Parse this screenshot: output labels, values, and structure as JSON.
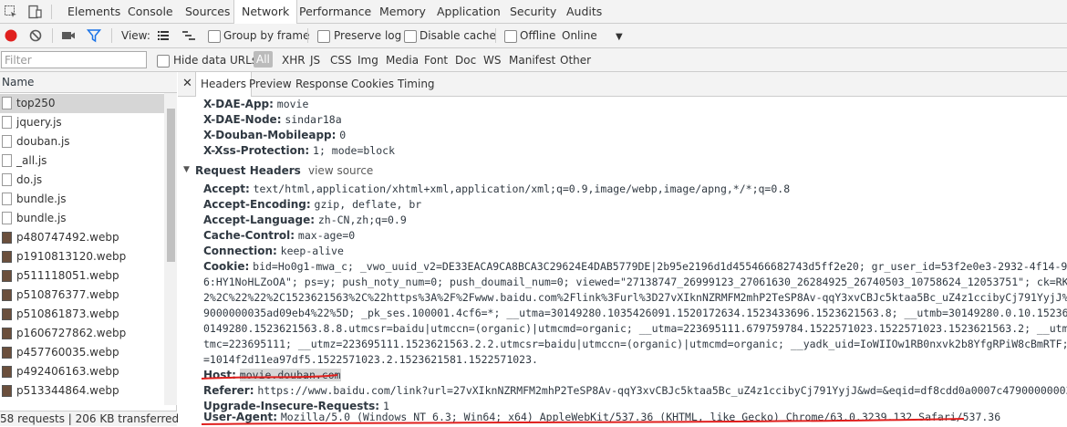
{
  "topbar": {
    "tabs": [
      "Elements",
      "Console",
      "Sources",
      "Network",
      "Performance",
      "Memory",
      "Application",
      "Security",
      "Audits"
    ],
    "active_tab": "Network"
  },
  "toolbar": {
    "view_label": "View:",
    "group_by_frame": "Group by frame",
    "preserve_log": "Preserve log",
    "disable_cache": "Disable cache",
    "offline": "Offline",
    "throttle": "Online"
  },
  "filterbar": {
    "placeholder": "Filter",
    "hide_data_urls": "Hide data URLs",
    "types": [
      "All",
      "XHR",
      "JS",
      "CSS",
      "Img",
      "Media",
      "Font",
      "Doc",
      "WS",
      "Manifest",
      "Other"
    ]
  },
  "requests": {
    "header": "Name",
    "items": [
      {
        "name": "top250",
        "kind": "doc"
      },
      {
        "name": "jquery.js",
        "kind": "doc"
      },
      {
        "name": "douban.js",
        "kind": "doc"
      },
      {
        "name": "_all.js",
        "kind": "doc"
      },
      {
        "name": "do.js",
        "kind": "doc"
      },
      {
        "name": "bundle.js",
        "kind": "doc"
      },
      {
        "name": "bundle.js",
        "kind": "doc"
      },
      {
        "name": "p480747492.webp",
        "kind": "img"
      },
      {
        "name": "p1910813120.webp",
        "kind": "img"
      },
      {
        "name": "p511118051.webp",
        "kind": "img"
      },
      {
        "name": "p510876377.webp",
        "kind": "img"
      },
      {
        "name": "p510861873.webp",
        "kind": "img"
      },
      {
        "name": "p1606727862.webp",
        "kind": "img"
      },
      {
        "name": "p457760035.webp",
        "kind": "img"
      },
      {
        "name": "p492406163.webp",
        "kind": "img"
      },
      {
        "name": "p513344864.webp",
        "kind": "img"
      }
    ],
    "status": "58 requests  |  206 KB transferred  |  F"
  },
  "detail_tabs": [
    "Headers",
    "Preview",
    "Response",
    "Cookies",
    "Timing"
  ],
  "response_headers": [
    {
      "key": "X-DAE-App:",
      "value": "movie"
    },
    {
      "key": "X-DAE-Node:",
      "value": "sindar18a"
    },
    {
      "key": "X-Douban-Mobileapp:",
      "value": "0"
    },
    {
      "key": "X-Xss-Protection:",
      "value": "1; mode=block"
    }
  ],
  "request_section": {
    "title": "Request Headers",
    "view_source": "view source"
  },
  "request_headers": {
    "accept": {
      "key": "Accept:",
      "value": "text/html,application/xhtml+xml,application/xml;q=0.9,image/webp,image/apng,*/*;q=0.8"
    },
    "accept_encoding": {
      "key": "Accept-Encoding:",
      "value": "gzip, deflate, br"
    },
    "accept_language": {
      "key": "Accept-Language:",
      "value": "zh-CN,zh;q=0.9"
    },
    "cache_control": {
      "key": "Cache-Control:",
      "value": "max-age=0"
    },
    "connection": {
      "key": "Connection:",
      "value": "keep-alive"
    },
    "cookie": {
      "key": "Cookie:",
      "value": "bid=Ho0g1-mwa_c; _vwo_uuid_v2=DE33EACA9CA8BCA3C29624E4DAB5779DE|2b95e2196d1d455466682743d5ff2e20; gr_user_id=53f2e0e3-2932-4f14-9f32-ce31",
      "lines": [
        "6:HY1NoHLZoOA\"; ps=y; push_noty_num=0; push_doumail_num=0; viewed=\"27138747_26999123_27061630_26284925_26740503_10758624_12053751\"; ck=RKgj; _pk",
        "2%2C%22%22%2C1523621563%2C%22https%3A%2F%2Fwww.baidu.com%2Flink%3Furl%3D27vXIknNZRMFM2mhP2TeSP8Av-qqY3xvCBJc5ktaa5Bc_uZ4z1ccibyCj791YyjJ%26wd%3D",
        "9000000035ad09eb4%22%5D; _pk_ses.100001.4cf6=*; __utma=30149280.1035426091.1520172634.1523433696.1523621563.8; __utmb=30149280.0.10.1523621563;",
        "0149280.1523621563.8.8.utmcsr=baidu|utmccn=(organic)|utmcmd=organic; __utma=223695111.679759784.1522571023.1522571023.1523621563.2; __utmb=22369",
        "tmc=223695111; __utmz=223695111.1523621563.2.2.utmcsr=baidu|utmccn=(organic)|utmcmd=organic; __yadk_uid=IoWIIOw1RB0nxvk2b8YfgRPiW8cBmRTF; ll=\"11",
        "=1014f2d11ea97df5.1522571023.2.1523621581.1522571023."
      ]
    },
    "host": {
      "key": "Host:",
      "value": "movie.douban.com"
    },
    "referer": {
      "key": "Referer:",
      "value": "https://www.baidu.com/link?url=27vXIknNZRMFM2mhP2TeSP8Av-qqY3xvCBJc5ktaa5Bc_uZ4z1ccibyCj791YyjJ&wd=&eqid=df8cdd0a0007c479000000035ad09eb"
    },
    "upgrade": {
      "key": "Upgrade-Insecure-Requests:",
      "value": "1"
    },
    "user_agent": {
      "key": "User-Agent:",
      "value": "Mozilla/5.0 (Windows NT 6.3; Win64; x64) AppleWebKit/537.36 (KHTML, like Gecko) Chrome/63.0.3239.132 Safari/537.36"
    }
  },
  "colors": {
    "record": "#e0201e",
    "filter_icon": "#1a73e8",
    "annotation": "#e0201e"
  }
}
